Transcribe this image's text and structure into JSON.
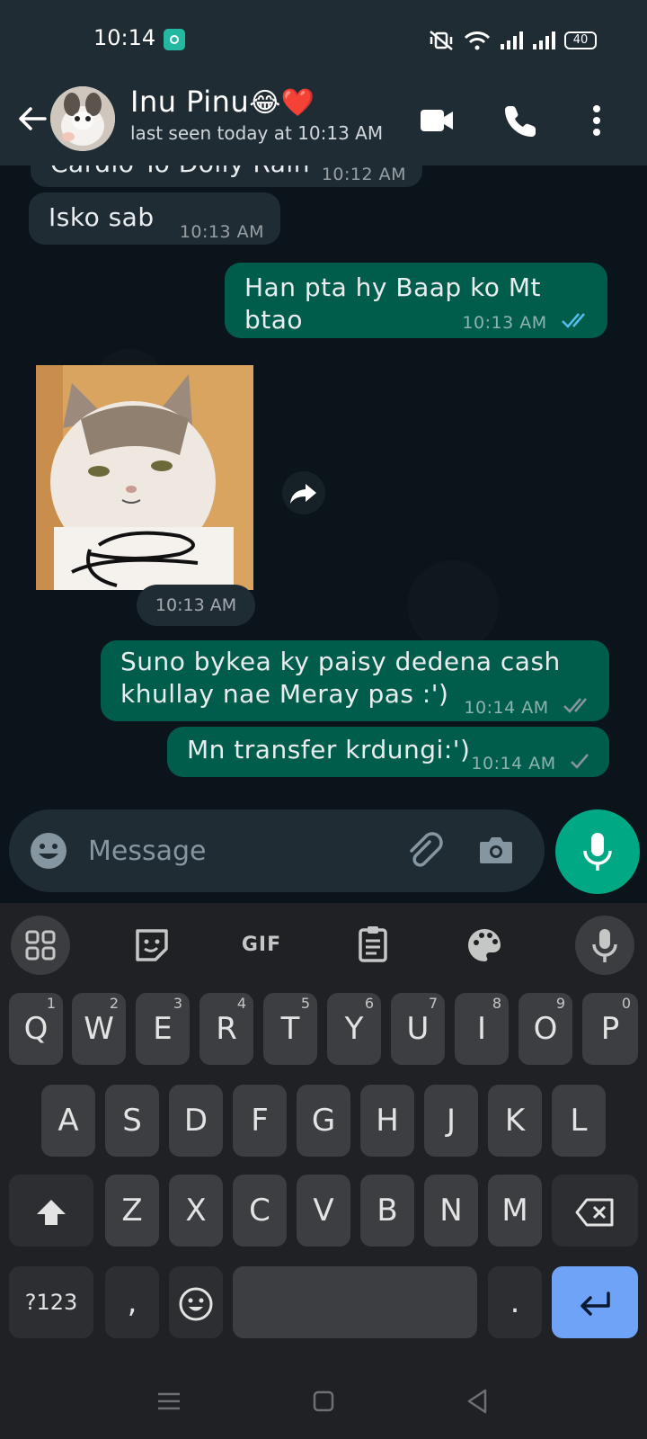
{
  "status_bar": {
    "time": "10:14",
    "battery": "40"
  },
  "header": {
    "contact_name": "Inu Pinu",
    "contact_emoji": "😂❤️",
    "last_seen": "last seen today at 10:13 AM"
  },
  "messages": [
    {
      "direction": "in",
      "text": "Cardio To Dolly Rain",
      "time": "10:12 AM"
    },
    {
      "direction": "in",
      "text": "Isko sab",
      "time": "10:13 AM"
    },
    {
      "direction": "out",
      "text": "Han pta hy Baap ko Mt btao",
      "time": "10:13 AM",
      "status": "read"
    },
    {
      "direction": "in",
      "type": "image",
      "time": "10:13 AM"
    },
    {
      "direction": "out",
      "text": "Suno bykea ky paisy dedena cash khullay nae Meray pas :')",
      "time": "10:14 AM",
      "status": "delivered"
    },
    {
      "direction": "out",
      "text": "Mn transfer krdungi:')",
      "time": "10:14 AM",
      "status": "sent"
    }
  ],
  "input": {
    "placeholder": "Message"
  },
  "keyboard": {
    "toolbar": {
      "gif_label": "GIF"
    },
    "row1": [
      {
        "label": "Q",
        "hint": "1"
      },
      {
        "label": "W",
        "hint": "2"
      },
      {
        "label": "E",
        "hint": "3"
      },
      {
        "label": "R",
        "hint": "4"
      },
      {
        "label": "T",
        "hint": "5"
      },
      {
        "label": "Y",
        "hint": "6"
      },
      {
        "label": "U",
        "hint": "7"
      },
      {
        "label": "I",
        "hint": "8"
      },
      {
        "label": "O",
        "hint": "9"
      },
      {
        "label": "P",
        "hint": "0"
      }
    ],
    "row2": [
      "A",
      "S",
      "D",
      "F",
      "G",
      "H",
      "J",
      "K",
      "L"
    ],
    "row3": [
      "Z",
      "X",
      "C",
      "V",
      "B",
      "N",
      "M"
    ],
    "symbols_label": "?123",
    "comma_label": ",",
    "period_label": "."
  },
  "colors": {
    "incoming_bubble": "#202c33",
    "outgoing_bubble": "#005c4b",
    "accent_green": "#00a884",
    "read_tick_blue": "#53bdeb",
    "enter_key": "#6fa3f7"
  },
  "icons": {
    "back": "arrow-left-icon",
    "video": "video-call-icon",
    "call": "phone-icon",
    "menu": "more-vertical-icon",
    "forward": "forward-icon",
    "emoji": "emoji-icon",
    "attach": "paperclip-icon",
    "camera": "camera-icon",
    "mic": "microphone-icon"
  }
}
